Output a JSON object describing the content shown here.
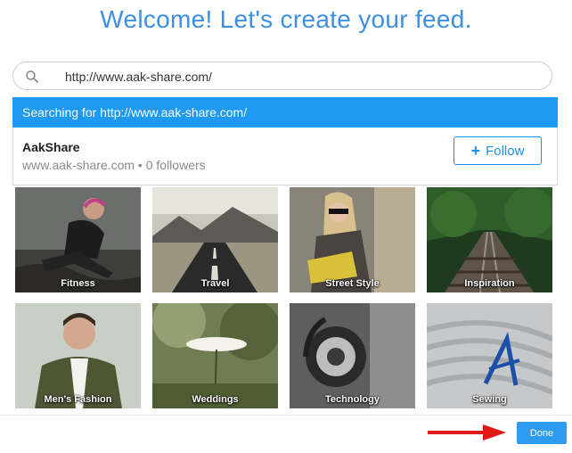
{
  "header": {
    "title": "Welcome! Let's create your feed."
  },
  "search": {
    "value": "http://www.aak-share.com/",
    "icon": "search-icon"
  },
  "dropdown": {
    "searching_text": "Searching for http://www.aak-share.com/",
    "result": {
      "name": "AakShare",
      "meta": "www.aak-share.com • 0 followers",
      "follow_label": "Follow"
    }
  },
  "categories": [
    {
      "label": "Fitness"
    },
    {
      "label": "Travel"
    },
    {
      "label": "Street Style"
    },
    {
      "label": "Inspiration"
    },
    {
      "label": "Men's Fashion"
    },
    {
      "label": "Weddings"
    },
    {
      "label": "Technology"
    },
    {
      "label": "Sewing"
    }
  ],
  "footer": {
    "done_label": "Done"
  },
  "colors": {
    "accent": "#1e9af3",
    "title": "#3d8fe0",
    "arrow": "#e01818"
  }
}
